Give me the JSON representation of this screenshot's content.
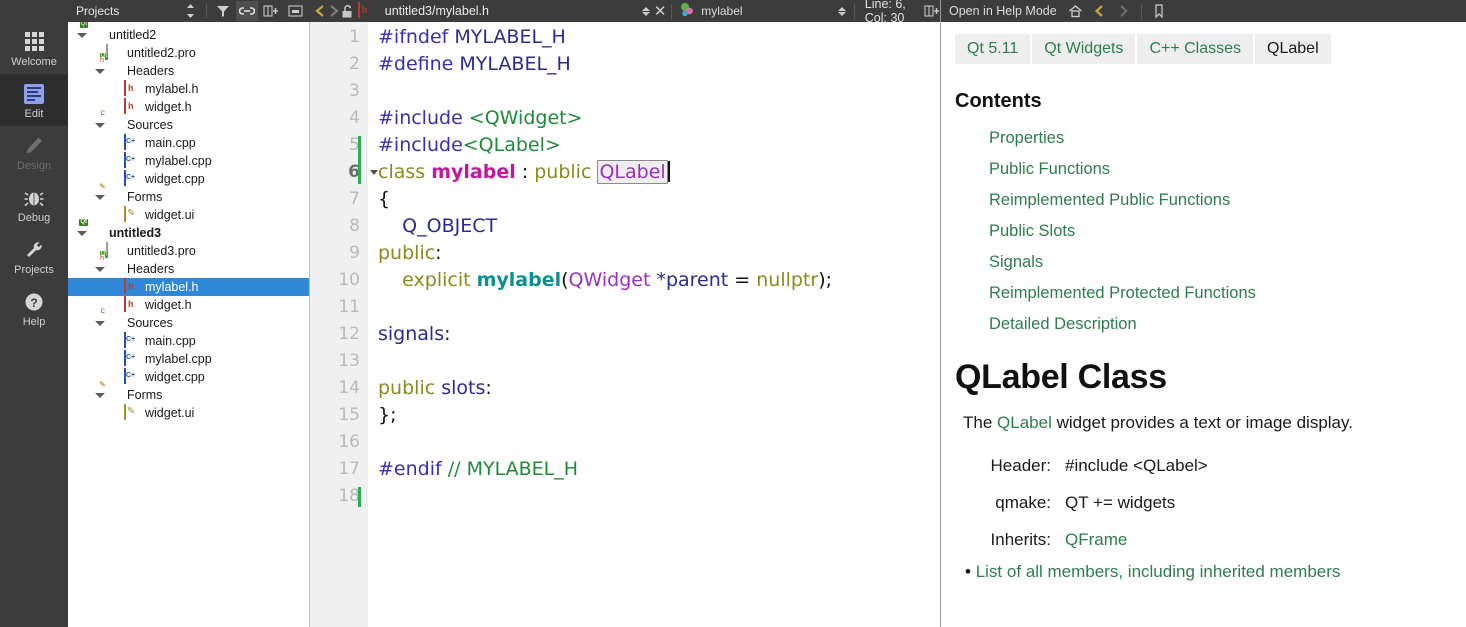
{
  "modebar": {
    "items": [
      {
        "label": "Welcome",
        "icon": "grid-icon",
        "state": "normal"
      },
      {
        "label": "Edit",
        "icon": "document-lines-icon",
        "state": "selected"
      },
      {
        "label": "Design",
        "icon": "pencil-icon",
        "state": "disabled"
      },
      {
        "label": "Debug",
        "icon": "bug-icon",
        "state": "normal"
      },
      {
        "label": "Projects",
        "icon": "wrench-icon",
        "state": "normal"
      },
      {
        "label": "Help",
        "icon": "question-mark-icon",
        "state": "normal"
      }
    ]
  },
  "projects": {
    "title": "Projects",
    "header_buttons": [
      {
        "name": "filter-icon",
        "glyph": "filter"
      },
      {
        "name": "link-with-editor-icon",
        "glyph": "link",
        "active": true
      },
      {
        "name": "add-split-icon",
        "glyph": "split-add"
      },
      {
        "name": "close-sidebar-icon",
        "glyph": "close-box"
      }
    ],
    "tree": [
      {
        "label": "untitled2",
        "indent": 1,
        "icon": "qt-project-icon",
        "arrow": "open",
        "bold": false,
        "selected": false
      },
      {
        "label": "untitled2.pro",
        "indent": 2,
        "icon": "pro-file-icon",
        "arrow": "none",
        "bold": false,
        "selected": false
      },
      {
        "label": "Headers",
        "indent": 2,
        "icon": "headers-folder-icon",
        "arrow": "open",
        "bold": false,
        "selected": false
      },
      {
        "label": "mylabel.h",
        "indent": 3,
        "icon": "h-file-icon",
        "arrow": "none",
        "bold": false,
        "selected": false
      },
      {
        "label": "widget.h",
        "indent": 3,
        "icon": "h-file-icon",
        "arrow": "none",
        "bold": false,
        "selected": false
      },
      {
        "label": "Sources",
        "indent": 2,
        "icon": "sources-folder-icon",
        "arrow": "open",
        "bold": false,
        "selected": false
      },
      {
        "label": "main.cpp",
        "indent": 3,
        "icon": "cpp-file-icon",
        "arrow": "none",
        "bold": false,
        "selected": false
      },
      {
        "label": "mylabel.cpp",
        "indent": 3,
        "icon": "cpp-file-icon",
        "arrow": "none",
        "bold": false,
        "selected": false
      },
      {
        "label": "widget.cpp",
        "indent": 3,
        "icon": "cpp-file-icon",
        "arrow": "none",
        "bold": false,
        "selected": false
      },
      {
        "label": "Forms",
        "indent": 2,
        "icon": "forms-folder-icon",
        "arrow": "open",
        "bold": false,
        "selected": false
      },
      {
        "label": "widget.ui",
        "indent": 3,
        "icon": "ui-file-icon",
        "arrow": "none",
        "bold": false,
        "selected": false
      },
      {
        "label": "untitled3",
        "indent": 1,
        "icon": "qt-project-icon",
        "arrow": "open",
        "bold": true,
        "selected": false
      },
      {
        "label": "untitled3.pro",
        "indent": 2,
        "icon": "pro-file-icon",
        "arrow": "none",
        "bold": false,
        "selected": false
      },
      {
        "label": "Headers",
        "indent": 2,
        "icon": "headers-folder-icon",
        "arrow": "open",
        "bold": false,
        "selected": false
      },
      {
        "label": "mylabel.h",
        "indent": 3,
        "icon": "h-file-icon",
        "arrow": "none",
        "bold": false,
        "selected": true
      },
      {
        "label": "widget.h",
        "indent": 3,
        "icon": "h-file-icon",
        "arrow": "none",
        "bold": false,
        "selected": false
      },
      {
        "label": "Sources",
        "indent": 2,
        "icon": "sources-folder-icon",
        "arrow": "open",
        "bold": false,
        "selected": false
      },
      {
        "label": "main.cpp",
        "indent": 3,
        "icon": "cpp-file-icon",
        "arrow": "none",
        "bold": false,
        "selected": false
      },
      {
        "label": "mylabel.cpp",
        "indent": 3,
        "icon": "cpp-file-icon",
        "arrow": "none",
        "bold": false,
        "selected": false
      },
      {
        "label": "widget.cpp",
        "indent": 3,
        "icon": "cpp-file-icon",
        "arrow": "none",
        "bold": false,
        "selected": false
      },
      {
        "label": "Forms",
        "indent": 2,
        "icon": "forms-folder-icon",
        "arrow": "open",
        "bold": false,
        "selected": false
      },
      {
        "label": "widget.ui",
        "indent": 3,
        "icon": "ui-file-icon",
        "arrow": "none",
        "bold": false,
        "selected": false
      }
    ]
  },
  "editor_toolbar": {
    "back_label": "❮",
    "forward_label": "❯",
    "lock_label": "unlock",
    "file_name": "untitled3/mylabel.h",
    "close_label": "✕",
    "symbol_name": "mylabel",
    "position": "Line: 6, Col: 30",
    "split_label": "split-editor"
  },
  "editor": {
    "lines": [
      {
        "n": "1",
        "current": false,
        "fold": false,
        "change": false
      },
      {
        "n": "2",
        "current": false,
        "fold": false,
        "change": false
      },
      {
        "n": "3",
        "current": false,
        "fold": false,
        "change": false
      },
      {
        "n": "4",
        "current": false,
        "fold": false,
        "change": false
      },
      {
        "n": "5",
        "current": false,
        "fold": false,
        "change": true
      },
      {
        "n": "6",
        "current": true,
        "fold": true,
        "change": true
      },
      {
        "n": "7",
        "current": false,
        "fold": false,
        "change": false
      },
      {
        "n": "8",
        "current": false,
        "fold": false,
        "change": false
      },
      {
        "n": "9",
        "current": false,
        "fold": false,
        "change": false
      },
      {
        "n": "10",
        "current": false,
        "fold": false,
        "change": false
      },
      {
        "n": "11",
        "current": false,
        "fold": false,
        "change": false
      },
      {
        "n": "12",
        "current": false,
        "fold": false,
        "change": false
      },
      {
        "n": "13",
        "current": false,
        "fold": false,
        "change": false
      },
      {
        "n": "14",
        "current": false,
        "fold": false,
        "change": false
      },
      {
        "n": "15",
        "current": false,
        "fold": false,
        "change": false
      },
      {
        "n": "16",
        "current": false,
        "fold": false,
        "change": false
      },
      {
        "n": "17",
        "current": false,
        "fold": false,
        "change": false
      },
      {
        "n": "18",
        "current": false,
        "fold": false,
        "change": false
      }
    ],
    "code_text": [
      "#ifndef MYLABEL_H",
      "#define MYLABEL_H",
      "",
      "#include <QWidget>",
      "#include<QLabel>",
      "class mylabel : public QLabel",
      "{",
      "    Q_OBJECT",
      "public:",
      "    explicit mylabel(QWidget *parent = nullptr);",
      "",
      "signals:",
      "",
      "public slots:",
      "};",
      "",
      "#endif // MYLABEL_H",
      ""
    ]
  },
  "help": {
    "toolbar": {
      "open_in_help_mode": "Open in Help Mode",
      "home_icon": "home-icon",
      "back_icon": "back-arrow-icon",
      "forward_icon": "forward-arrow-icon",
      "bookmark_icon": "bookmark-icon"
    },
    "breadcrumbs": [
      {
        "label": "Qt 5.11",
        "current": false
      },
      {
        "label": "Qt Widgets",
        "current": false
      },
      {
        "label": "C++ Classes",
        "current": false
      },
      {
        "label": "QLabel",
        "current": true
      }
    ],
    "contents_heading": "Contents",
    "toc": [
      "Properties",
      "Public Functions",
      "Reimplemented Public Functions",
      "Public Slots",
      "Signals",
      "Reimplemented Protected Functions",
      "Detailed Description"
    ],
    "class_title": "QLabel Class",
    "description": {
      "before": "The ",
      "link": "QLabel",
      "after": " widget provides a text or image display."
    },
    "properties": [
      {
        "key": "Header:",
        "value": "#include <QLabel>",
        "link": false
      },
      {
        "key": "qmake:",
        "value": "QT += widgets",
        "link": false
      },
      {
        "key": "Inherits:",
        "value": "QFrame",
        "link": true
      }
    ],
    "members_link": "List of all members, including inherited members",
    "bullet": "•"
  },
  "colors": {
    "chrome": "#3c3c3c",
    "selection": "#2f87d8",
    "gutter": "#f0f0f0",
    "link_green": "#2e7d4f",
    "change_bar": "#2eae52"
  }
}
